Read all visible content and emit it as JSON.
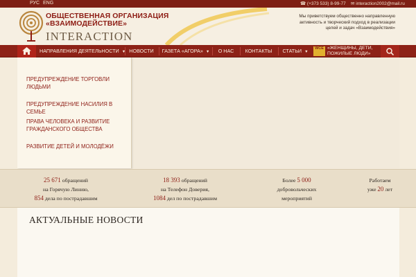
{
  "topbar": {
    "lang_ru": "РУС",
    "lang_en": "ENG",
    "phone": "(+373 533) 8-99-77",
    "email": "interaction2002@mail.ru"
  },
  "header": {
    "org_line1": "ОБЩЕСТВЕННАЯ ОРГАНИЗАЦИЯ",
    "org_line2": "«ВЗАИМОДЕЙСТВИЕ»",
    "brand": "INTERACTION",
    "welcome": "Мы приветствуем общественно направленную активность и творческий подход в реализации целей и задач «Взаимодействия»"
  },
  "nav": {
    "items": [
      {
        "label": "НАПРАВЛЕНИЯ ДЕЯТЕЛЬНОСТИ",
        "caret": "▼"
      },
      {
        "label": "НОВОСТИ",
        "caret": ""
      },
      {
        "label": "ГАЗЕТА «АГОРА»",
        "caret": "▼"
      },
      {
        "label": "О НАС",
        "caret": ""
      },
      {
        "label": "КОНТАКТЫ",
        "caret": ""
      },
      {
        "label": "СТАТЬИ",
        "caret": "▼"
      }
    ],
    "wce_badge": "WCE",
    "wce_label": "«ЖЕНЩИНЫ, ДЕТИ, ПОЖИЛЫЕ ЛЮДИ»"
  },
  "dropdown": {
    "items": [
      "ПРЕДУПРЕЖДЕНИЕ ТОРГОВЛИ ЛЮДЬМИ",
      "ПРЕДУПРЕЖДЕНИЕ НАСИЛИЯ В СЕМЬЕ",
      "ПРАВА ЧЕЛОВЕКА И РАЗВИТИЕ ГРАЖДАНСКОГО ОБЩЕСТВА",
      "РАЗВИТИЕ ДЕТЕЙ И МОЛОДЁЖИ"
    ]
  },
  "stats": {
    "s1": {
      "n1": "25 671",
      "t1": " обращений",
      "t2": "на Горячую Линию,",
      "n2": "854",
      "t3": " дела по пострадавшим"
    },
    "s2": {
      "n1": "18 393",
      "t1": " обращений",
      "t2": "на Телефон Доверия,",
      "n2": "1084",
      "t3": " дел по пострадавшим"
    },
    "s3": {
      "t0": "Более ",
      "n1": "5 000",
      "t1": "добровольческих",
      "t2": "мероприятий"
    },
    "s4": {
      "t1": "Работаем",
      "t2": "уже ",
      "n1": "20",
      "t3": " лет"
    }
  },
  "news": {
    "title": "АКТУАЛЬНЫЕ НОВОСТИ"
  },
  "colors": {
    "brand_red": "#8d2217",
    "accent_red": "#8d1c14",
    "background": "#f4ecdc",
    "gold": "#e2b12f"
  },
  "icons": {
    "home": "home-icon",
    "search": "search-icon",
    "logo": "tree-logo-icon"
  }
}
